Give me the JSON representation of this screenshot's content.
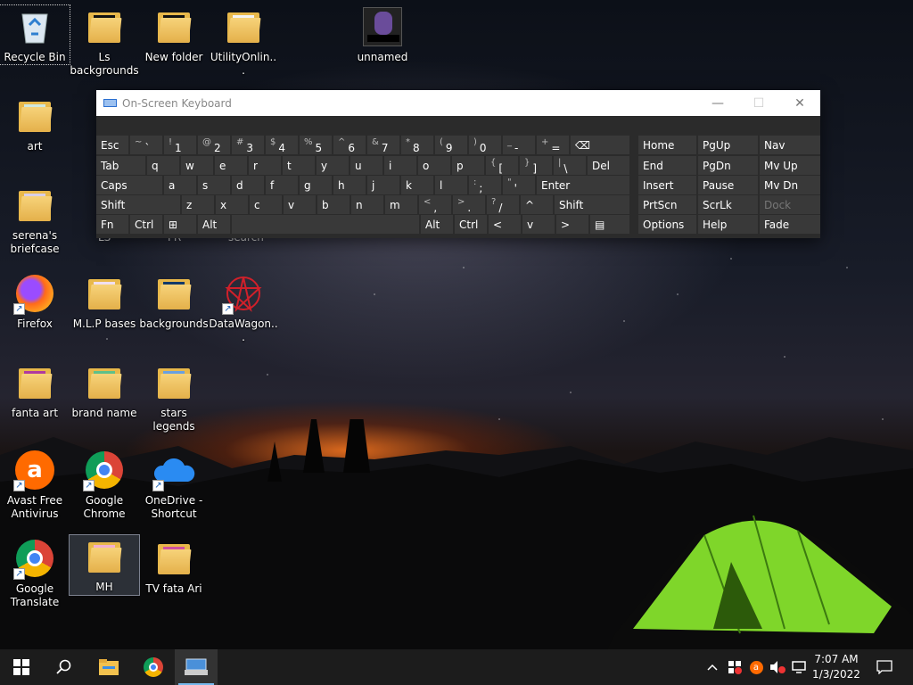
{
  "desktop": {
    "icons": [
      {
        "label": "Recycle Bin"
      },
      {
        "label": "Ls backgrounds"
      },
      {
        "label": "New folder"
      },
      {
        "label": "UtilityOnlin..."
      },
      {
        "label": "unnamed"
      },
      {
        "label": "art"
      },
      {
        "label": "serena's briefcase"
      },
      {
        "label": "Firefox"
      },
      {
        "label": "M.L.P bases"
      },
      {
        "label": "backgrounds"
      },
      {
        "label": "DataWagon..."
      },
      {
        "label": "fanta art"
      },
      {
        "label": "brand name"
      },
      {
        "label": "stars legends"
      },
      {
        "label": "Avast Free Antivirus"
      },
      {
        "label": "Google Chrome"
      },
      {
        "label": "OneDrive - Shortcut"
      },
      {
        "label": "Google Translate"
      },
      {
        "label": "MH"
      },
      {
        "label": "TV fata Ari"
      }
    ],
    "partial_labels": [
      "LS",
      "FR",
      "search"
    ]
  },
  "osk": {
    "title": "On-Screen Keyboard",
    "row1": [
      {
        "m": "Esc"
      },
      {
        "s": "~",
        "m": "`"
      },
      {
        "s": "!",
        "m": "1"
      },
      {
        "s": "@",
        "m": "2"
      },
      {
        "s": "#",
        "m": "3"
      },
      {
        "s": "$",
        "m": "4"
      },
      {
        "s": "%",
        "m": "5"
      },
      {
        "s": "^",
        "m": "6"
      },
      {
        "s": "&",
        "m": "7"
      },
      {
        "s": "*",
        "m": "8"
      },
      {
        "s": "(",
        "m": "9"
      },
      {
        "s": ")",
        "m": "0"
      },
      {
        "s": "_",
        "m": "-"
      },
      {
        "s": "+",
        "m": "="
      },
      {
        "m": "⌫"
      }
    ],
    "row2": [
      {
        "m": "Tab"
      },
      {
        "m": "q"
      },
      {
        "m": "w"
      },
      {
        "m": "e"
      },
      {
        "m": "r"
      },
      {
        "m": "t"
      },
      {
        "m": "y"
      },
      {
        "m": "u"
      },
      {
        "m": "i"
      },
      {
        "m": "o"
      },
      {
        "m": "p"
      },
      {
        "s": "{",
        "m": "["
      },
      {
        "s": "}",
        "m": "]"
      },
      {
        "s": "|",
        "m": "\\"
      },
      {
        "m": "Del"
      }
    ],
    "row3": [
      {
        "m": "Caps"
      },
      {
        "m": "a"
      },
      {
        "m": "s"
      },
      {
        "m": "d"
      },
      {
        "m": "f"
      },
      {
        "m": "g"
      },
      {
        "m": "h"
      },
      {
        "m": "j"
      },
      {
        "m": "k"
      },
      {
        "m": "l"
      },
      {
        "s": ":",
        "m": ";"
      },
      {
        "s": "\"",
        "m": "'"
      },
      {
        "m": "Enter"
      }
    ],
    "row4": [
      {
        "m": "Shift"
      },
      {
        "m": "z"
      },
      {
        "m": "x"
      },
      {
        "m": "c"
      },
      {
        "m": "v"
      },
      {
        "m": "b"
      },
      {
        "m": "n"
      },
      {
        "m": "m"
      },
      {
        "s": "<",
        "m": ","
      },
      {
        "s": ">",
        "m": "."
      },
      {
        "s": "?",
        "m": "/"
      },
      {
        "m": "^"
      },
      {
        "m": "Shift"
      }
    ],
    "row5": [
      {
        "m": "Fn"
      },
      {
        "m": "Ctrl"
      },
      {
        "m": "⊞"
      },
      {
        "m": "Alt"
      },
      {
        "m": ""
      },
      {
        "m": "Alt"
      },
      {
        "m": "Ctrl"
      },
      {
        "m": "<"
      },
      {
        "m": "v"
      },
      {
        "m": ">"
      },
      {
        "m": "▤"
      }
    ],
    "nav": [
      [
        "Home",
        "PgUp",
        "Nav"
      ],
      [
        "End",
        "PgDn",
        "Mv Up"
      ],
      [
        "Insert",
        "Pause",
        "Mv Dn"
      ],
      [
        "PrtScn",
        "ScrLk",
        "Dock"
      ],
      [
        "Options",
        "Help",
        "Fade"
      ]
    ]
  },
  "taskbar": {
    "time": "7:07 AM",
    "date": "1/3/2022"
  }
}
